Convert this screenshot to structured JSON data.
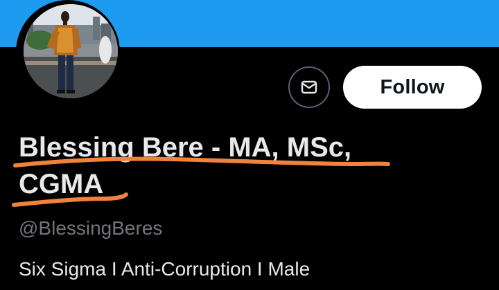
{
  "profile": {
    "display_name": "Blessing Bere - MA, MSc, CGMA",
    "handle": "@BlessingBeres",
    "bio": "Six Sigma I Anti-Corruption I Male"
  },
  "actions": {
    "message_icon": "envelope-icon",
    "follow_label": "Follow"
  },
  "colors": {
    "banner": "#1d9bf0",
    "background": "#000000",
    "annotation_underline": "#f0823c"
  }
}
